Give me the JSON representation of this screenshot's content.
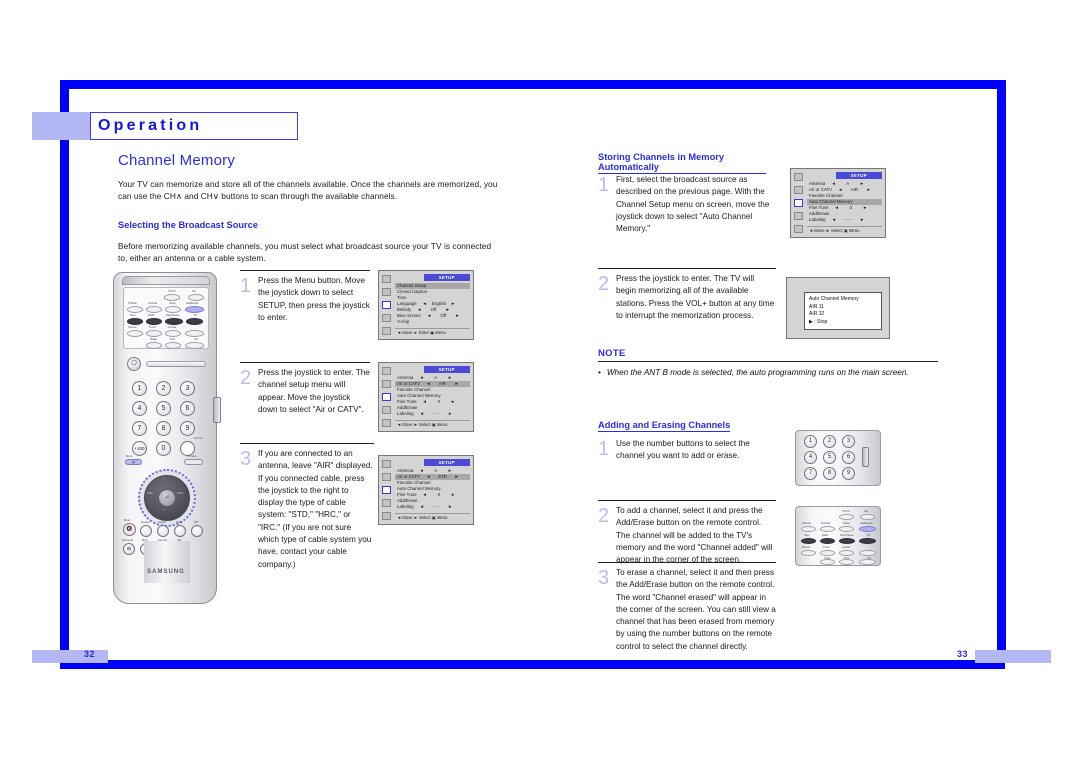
{
  "document": {
    "chapter": "Operation",
    "page_left": "32",
    "page_right": "33"
  },
  "left_column": {
    "title": "Channel Memory",
    "intro": "Your TV can memorize and store all of the channels available. Once the channels are memorized, you can use the CH∧ and CH∨ buttons to scan through the available channels.",
    "subsection": "Selecting the Broadcast Source",
    "subsection_body": "Before memorizing available channels, you must select what broadcast source your TV is connected to, either an antenna or a cable system.",
    "steps": [
      {
        "num": "1",
        "text": "Press the Menu button. Move the joystick down to select SETUP, then press the joystick to enter."
      },
      {
        "num": "2",
        "text": "Press the joystick to enter. The channel setup menu will appear. Move the joystick down to select \"Air or CATV\"."
      },
      {
        "num": "3",
        "text": "If you are connected to an antenna, leave \"AIR\" displayed. If you connected cable, press the joystick to the right to display the type of cable system: \"STD,\" \"HRC,\" or \"IRC.\" (If you are not sure which type of cable system you have, contact your cable company.)"
      }
    ]
  },
  "right_column": {
    "section1_title": "Storing Channels in Memory Automatically",
    "section1_steps": [
      {
        "num": "1",
        "text": "First, select the broadcast source as described on the previous page. With the Channel Setup menu on screen, move the joystick down to select \"Auto Channel Memory.\""
      },
      {
        "num": "2",
        "text": "Press the joystick to enter. The TV will begin memorizing all of the available stations. Press the VOL+ button at any time to interrupt the memorization process."
      }
    ],
    "note_heading": "NOTE",
    "note_bullet": "•",
    "note_text": "When the ANT B mode is selected, the auto programming runs on the main screen.",
    "section2_title": "Adding and Erasing Channels",
    "section2_steps": [
      {
        "num": "1",
        "text": "Use the number buttons to select the channel you want to add or erase."
      },
      {
        "num": "2",
        "text": "To add a channel, select it and press the Add/Erase button on the remote control. The channel will be added to the TV's memory and the word \"Channel added\" will appear in the corner of the screen."
      },
      {
        "num": "3",
        "text": "To erase a channel, select it and then press the Add/Erase button on the remote control. The word \"Channel erased\" will appear in the corner of the screen. You can still view a channel that has been erased from memory by using the number buttons on the remote control to select the channel directly."
      }
    ]
  },
  "osd_menus": {
    "setup_main": {
      "title": "SETUP",
      "items": [
        {
          "label": "Channel Setup",
          "arrow_left": "",
          "value": "",
          "arrow_right": "",
          "highlight": true
        },
        {
          "label": "Closed Caption",
          "arrow_left": "",
          "value": "",
          "arrow_right": "",
          "highlight": false
        },
        {
          "label": "Time",
          "arrow_left": "",
          "value": "",
          "arrow_right": "",
          "highlight": false
        },
        {
          "label": "Language",
          "arrow_left": "◄",
          "value": "English",
          "arrow_right": "►",
          "highlight": false
        },
        {
          "label": "Melody",
          "arrow_left": "◄",
          "value": "Off",
          "arrow_right": "►",
          "highlight": false
        },
        {
          "label": "Blue Screen",
          "arrow_left": "◄",
          "value": "Off",
          "arrow_right": "►",
          "highlight": false
        },
        {
          "label": "V-chip",
          "arrow_left": "",
          "value": "",
          "arrow_right": "",
          "highlight": false
        }
      ],
      "footer": "◄ Move   ► Enter   ▣ Menu"
    },
    "channel_setup_air": {
      "title": "SETUP",
      "items": [
        {
          "label": "Antenna",
          "arrow_left": "◄",
          "value": "A",
          "arrow_right": "►",
          "highlight": false
        },
        {
          "label": "Air or CATV",
          "arrow_left": "◄",
          "value": "AIR",
          "arrow_right": "►",
          "highlight": true
        },
        {
          "label": "Favorite Channel",
          "arrow_left": "",
          "value": "",
          "arrow_right": "",
          "highlight": false
        },
        {
          "label": "Auto Channel Memory",
          "arrow_left": "",
          "value": "",
          "arrow_right": "",
          "highlight": false
        },
        {
          "label": "Fine Tune",
          "arrow_left": "◄",
          "value": "0",
          "arrow_right": "►",
          "highlight": false
        },
        {
          "label": "Add/Erase",
          "arrow_left": "",
          "value": "",
          "arrow_right": "",
          "highlight": false
        },
        {
          "label": "Labeling",
          "arrow_left": "◄",
          "value": "- - - -",
          "arrow_right": "►",
          "highlight": false
        }
      ],
      "footer": "◄ Move   ► Select   ▣ Menu"
    },
    "channel_setup_std": {
      "title": "SETUP",
      "items": [
        {
          "label": "Antenna",
          "arrow_left": "◄",
          "value": "A",
          "arrow_right": "►",
          "highlight": false
        },
        {
          "label": "Air or CATV",
          "arrow_left": "◄",
          "value": "STD",
          "arrow_right": "►",
          "highlight": true
        },
        {
          "label": "Favorite Channel",
          "arrow_left": "",
          "value": "",
          "arrow_right": "",
          "highlight": false
        },
        {
          "label": "Auto Channel Memory",
          "arrow_left": "",
          "value": "",
          "arrow_right": "",
          "highlight": false
        },
        {
          "label": "Fine Tune",
          "arrow_left": "◄",
          "value": "0",
          "arrow_right": "►",
          "highlight": false
        },
        {
          "label": "Add/Erase",
          "arrow_left": "",
          "value": "",
          "arrow_right": "",
          "highlight": false
        },
        {
          "label": "Labeling",
          "arrow_left": "◄",
          "value": "- - - -",
          "arrow_right": "►",
          "highlight": false
        }
      ],
      "footer": "◄ Move   ► Select   ▣ Menu"
    },
    "channel_setup_acm": {
      "title": "SETUP",
      "items": [
        {
          "label": "Antenna",
          "arrow_left": "◄",
          "value": "A",
          "arrow_right": "►",
          "highlight": false
        },
        {
          "label": "Air or CATV",
          "arrow_left": "◄",
          "value": "AIR",
          "arrow_right": "►",
          "highlight": false
        },
        {
          "label": "Favorite Channel",
          "arrow_left": "",
          "value": "",
          "arrow_right": "",
          "highlight": false
        },
        {
          "label": "Auto Channel Memory",
          "arrow_left": "",
          "value": "",
          "arrow_right": "",
          "highlight": true
        },
        {
          "label": "Fine Tune",
          "arrow_left": "◄",
          "value": "0",
          "arrow_right": "►",
          "highlight": false
        },
        {
          "label": "Add/Erase",
          "arrow_left": "",
          "value": "",
          "arrow_right": "",
          "highlight": false
        },
        {
          "label": "Labeling",
          "arrow_left": "◄",
          "value": "- - - -",
          "arrow_right": "►",
          "highlight": false
        }
      ],
      "footer": "◄ Move   ► Select   ▣ Menu"
    },
    "auto_channel_memory_dialog": {
      "line1": "Auto Channel Memory",
      "line2": "AIR 11",
      "line3": "AIR 32",
      "line4": "▶ :  Stop"
    }
  },
  "remote": {
    "brand": "SAMSUNG",
    "top_buttons": [
      "TV/Vtr",
      "Set",
      "TV Mode",
      "S.Mode",
      "Sleep",
      "Add/Erase",
      "Stop",
      "REW",
      "Play/Pause",
      "FF",
      "Source",
      "Tuner",
      "Locate",
      "Swap",
      "Size",
      "CH"
    ],
    "number_keys": [
      "1",
      "2",
      "3",
      "4",
      "5",
      "6",
      "7",
      "8",
      "9",
      "+100",
      "0"
    ],
    "pre_ch_label": "Pre-CH",
    "menu_label": "Menu",
    "tv_video_label": "TV/Video",
    "mute_label": "Mute",
    "joystick_labels": [
      "VOL−",
      "VOL+",
      "CH∧",
      "CH∨",
      "Enter"
    ],
    "bottom_buttons": [
      "Display",
      "Aspect",
      "DNIe",
      "PIP",
      "Surround",
      "MTS",
      "Fav.CH",
      "Still"
    ]
  },
  "colors": {
    "frame_blue": "#0000ff",
    "accent_blue": "#2b2be8",
    "light_blue": "#b3b8f5",
    "step_number": "#b9bdf0",
    "osd_title_bg": "#4a4ad8",
    "osd_bg": "#d4d4d4"
  }
}
